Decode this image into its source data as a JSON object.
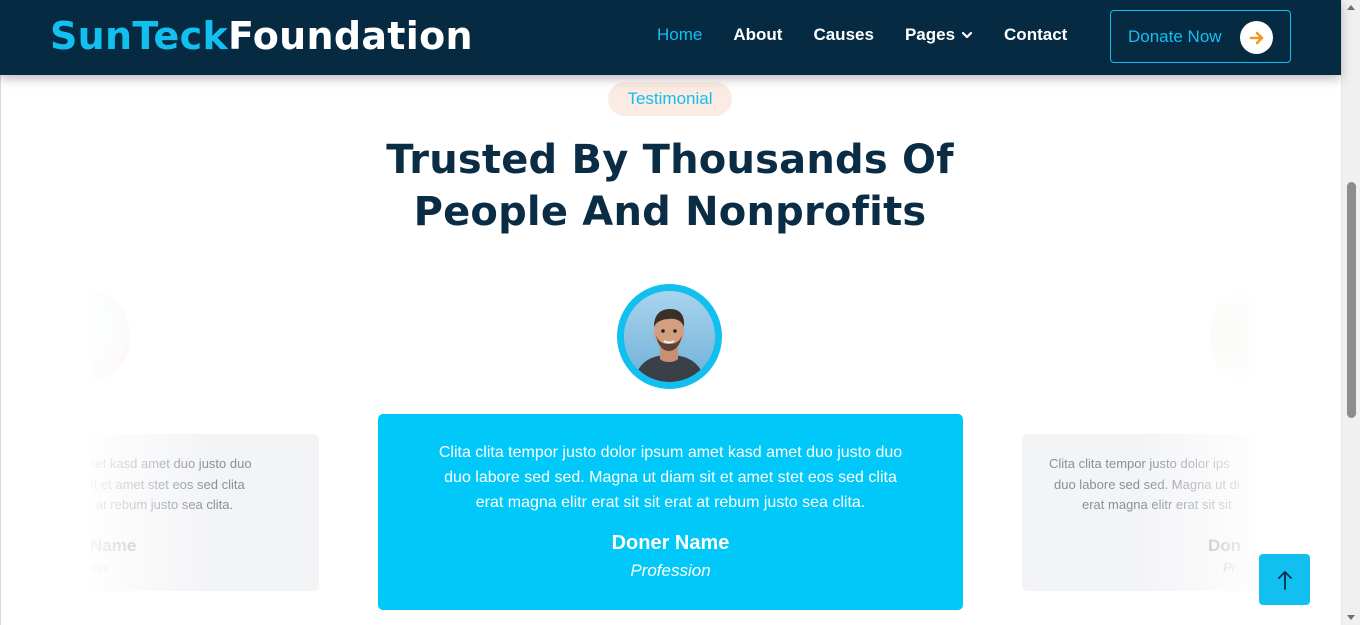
{
  "brand": {
    "part1": "SunTeck",
    "part2": "Foundation"
  },
  "nav": {
    "items": [
      {
        "label": "Home",
        "active": true
      },
      {
        "label": "About"
      },
      {
        "label": "Causes"
      },
      {
        "label": "Pages",
        "dropdown": true
      },
      {
        "label": "Contact"
      }
    ],
    "donate_label": "Donate Now"
  },
  "section": {
    "badge": "Testimonial",
    "title_line1": "Trusted By Thousands Of",
    "title_line2": "People And Nonprofits"
  },
  "testimonials": {
    "center": {
      "quote_line1": "Clita clita tempor justo dolor ipsum amet kasd amet duo justo duo",
      "quote_line2": "duo labore sed sed. Magna ut diam sit et amet stet eos sed clita",
      "quote_line3": "erat magna elitr erat sit sit erat at rebum justo sea clita.",
      "name": "Doner Name",
      "profession": "Profession"
    },
    "left": {
      "quote_line1": "amet kasd amet duo justo duo",
      "quote_line2": "sit et amet stet eos sed clita",
      "quote_line3": "at rebum justo sea clita.",
      "name": "Name",
      "profession": "ion"
    },
    "right": {
      "quote_line1": "Clita clita tempor justo dolor ips",
      "quote_line2": "duo labore sed sed. Magna ut di",
      "quote_line3": "erat magna elitr erat sit sit",
      "name": "Don",
      "profession": "Pr"
    }
  },
  "colors": {
    "navbar_bg": "#062a42",
    "accent": "#12c0f0",
    "card_bg": "#00c8f8",
    "heading": "#0a2c44",
    "badge_bg": "#fbebe3",
    "donate_arrow": "#f39a1e"
  },
  "icons": {
    "donate": "arrow-right-icon",
    "pages_dropdown": "chevron-down-icon",
    "back_to_top": "arrow-up-icon"
  }
}
